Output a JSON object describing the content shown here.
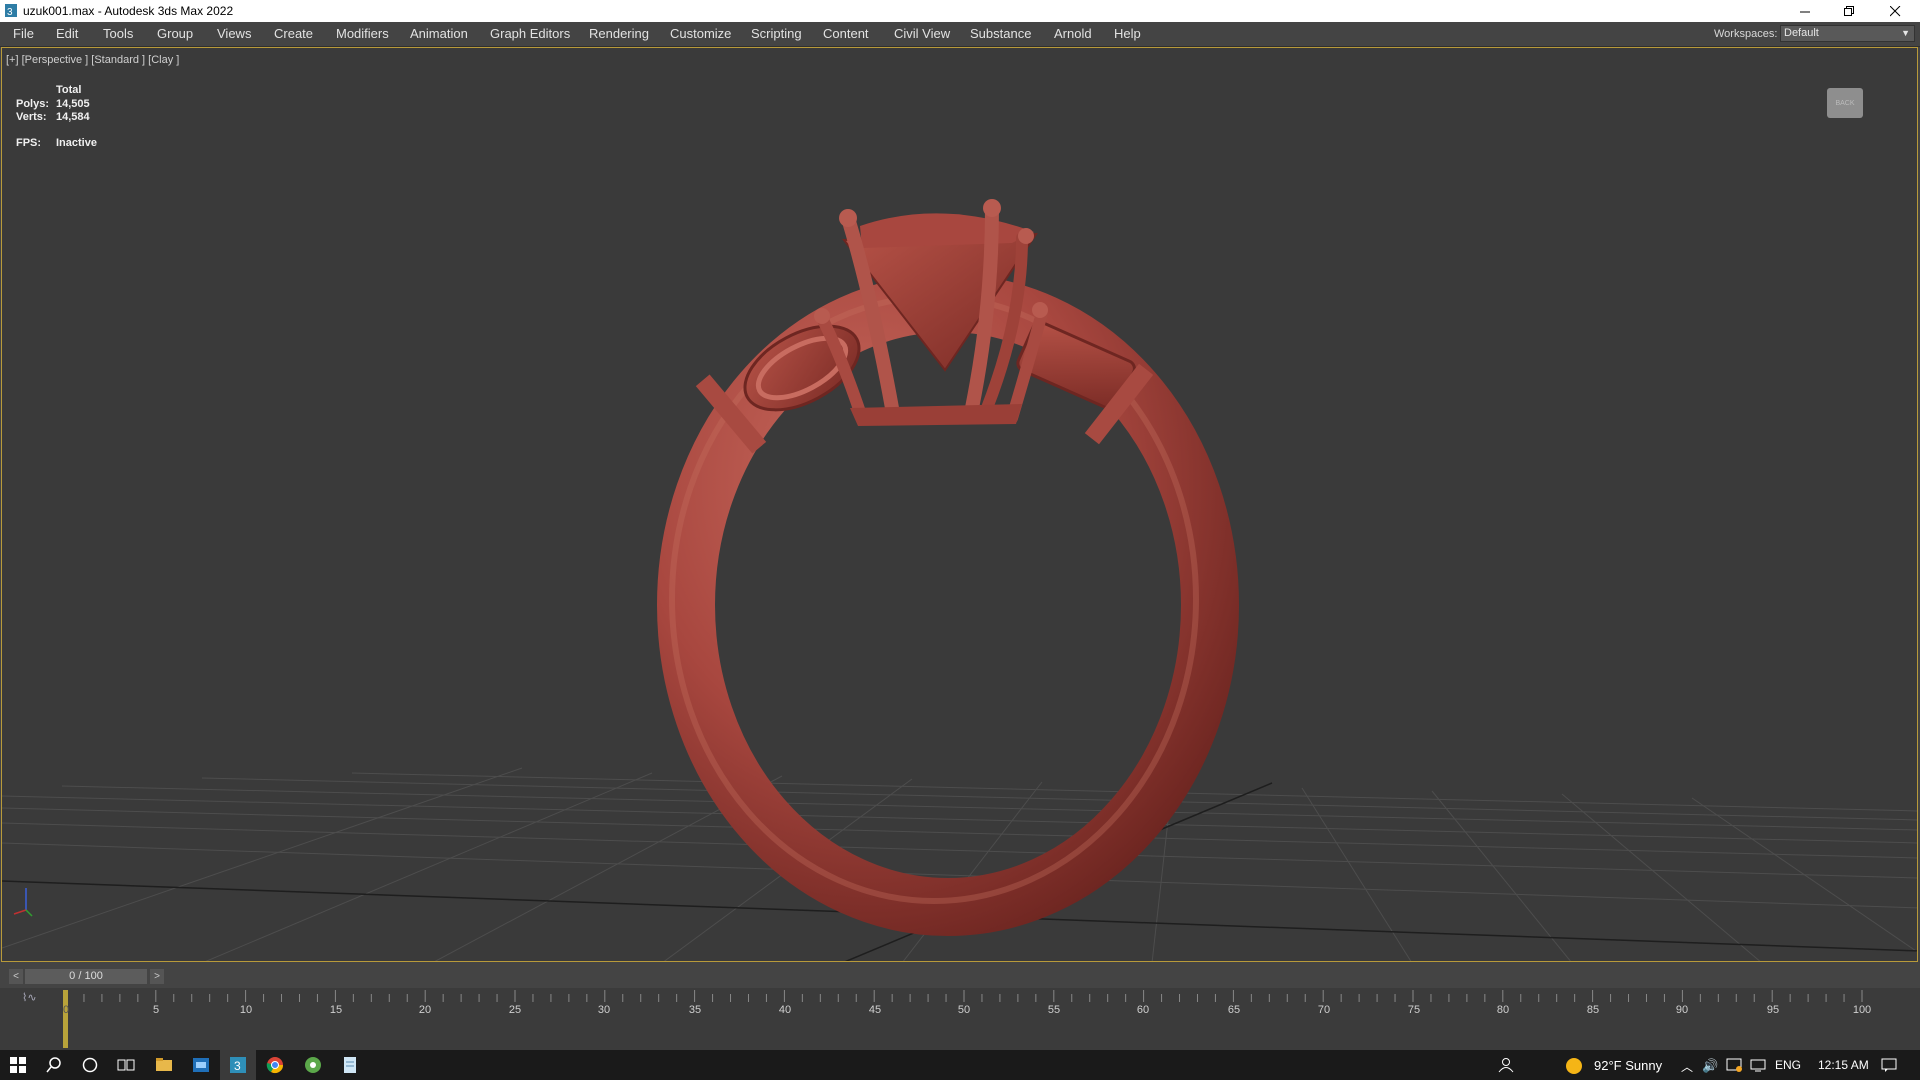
{
  "window": {
    "title": "uzuk001.max - Autodesk 3ds Max 2022"
  },
  "menu": [
    "File",
    "Edit",
    "Tools",
    "Group",
    "Views",
    "Create",
    "Modifiers",
    "Animation",
    "Graph Editors",
    "Rendering",
    "Customize",
    "Scripting",
    "Content",
    "Civil View",
    "Substance",
    "Arnold",
    "Help"
  ],
  "workspace": {
    "label": "Workspaces:",
    "value": "Default"
  },
  "viewport": {
    "label": "[+] [Perspective ] [Standard ] [Clay ]",
    "stats": {
      "header": "Total",
      "polys_label": "Polys:",
      "polys": "14,505",
      "verts_label": "Verts:",
      "verts": "14,584",
      "fps_label": "FPS:",
      "fps": "Inactive"
    },
    "viewcube_label": "BACK"
  },
  "timeline": {
    "frame_display": "0 / 100",
    "prev": "<",
    "next": ">",
    "ticks": [
      "5",
      "10",
      "15",
      "20",
      "25",
      "30",
      "35",
      "40",
      "45",
      "50",
      "55",
      "60",
      "65",
      "70",
      "75",
      "80",
      "85",
      "90",
      "95",
      "100"
    ],
    "start": "0"
  },
  "taskbar": {
    "weather": "92°F  Sunny",
    "language": "ENG",
    "time": "12:15 AM"
  },
  "colors": {
    "ring": "#a8473f",
    "viewport_bg": "#3a3a3a",
    "border": "#b89a3a"
  },
  "icons": [
    "app-icon",
    "minimize-icon",
    "restore-icon",
    "close-icon",
    "windows-start-icon",
    "search-icon",
    "cortana-icon",
    "task-view-icon",
    "file-explorer-icon",
    "app-icon-blue",
    "3dsmax-taskbar-icon",
    "chrome-icon",
    "green-app-icon",
    "notes-icon",
    "people-icon",
    "weather-sun-icon",
    "chevron-up-icon",
    "volume-icon",
    "network-icon",
    "notification-icon"
  ]
}
